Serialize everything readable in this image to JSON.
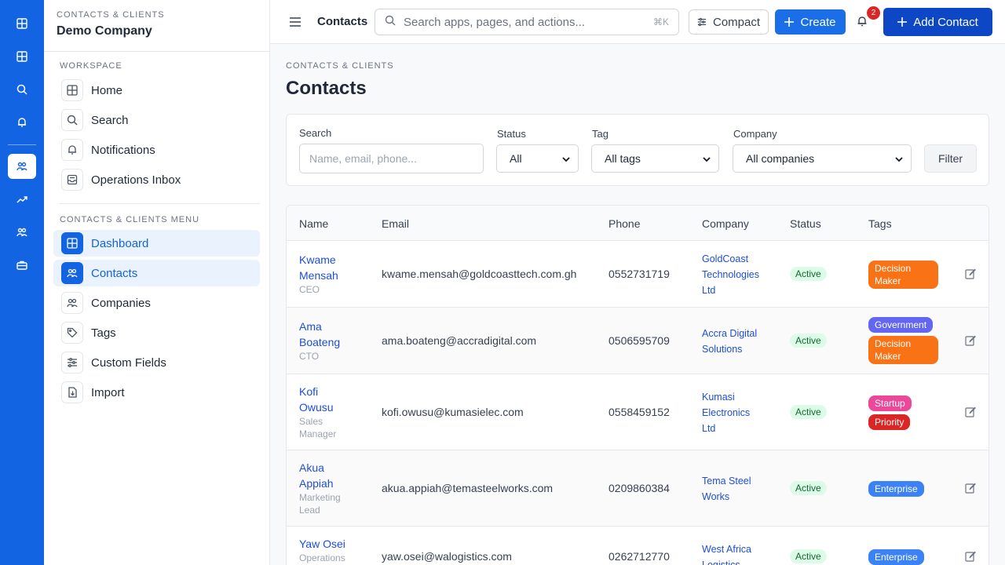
{
  "sidebar": {
    "kicker": "CONTACTS & CLIENTS",
    "company": "Demo Company",
    "workspace_title": "WORKSPACE",
    "workspace_items": [
      {
        "label": "Home",
        "icon": "grid-icon"
      },
      {
        "label": "Search",
        "icon": "search-icon"
      },
      {
        "label": "Notifications",
        "icon": "bell-icon"
      },
      {
        "label": "Operations Inbox",
        "icon": "inbox-icon"
      }
    ],
    "menu_title": "CONTACTS & CLIENTS MENU",
    "menu_items": [
      {
        "label": "Dashboard",
        "icon": "grid-icon",
        "active": true
      },
      {
        "label": "Contacts",
        "icon": "users-icon",
        "active": true
      },
      {
        "label": "Companies",
        "icon": "users-icon",
        "active": false
      },
      {
        "label": "Tags",
        "icon": "tag-icon",
        "active": false
      },
      {
        "label": "Custom Fields",
        "icon": "sliders-icon",
        "active": false
      },
      {
        "label": "Import",
        "icon": "file-import-icon",
        "active": false
      }
    ]
  },
  "topbar": {
    "title": "Contacts",
    "search_placeholder": "Search apps, pages, and actions...",
    "shortcut": "⌘K",
    "compact_label": "Compact",
    "create_label": "Create",
    "notification_count": "2",
    "add_contact_label": "Add Contact"
  },
  "page": {
    "breadcrumb": "CONTACTS & CLIENTS",
    "title": "Contacts"
  },
  "filters": {
    "search_label": "Search",
    "search_placeholder": "Name, email, phone...",
    "status_label": "Status",
    "status_value": "All",
    "tag_label": "Tag",
    "tag_value": "All tags",
    "company_label": "Company",
    "company_value": "All companies",
    "filter_button": "Filter"
  },
  "table": {
    "headers": [
      "Name",
      "Email",
      "Phone",
      "Company",
      "Status",
      "Tags"
    ],
    "rows": [
      {
        "name_l1": "Kwame",
        "name_l2": "Mensah",
        "role_l1": "CEO",
        "role_l2": "",
        "email": "kwame.mensah@goldcoasttech.com.gh",
        "phone": "0552731719",
        "company_l1": "GoldCoast",
        "company_l2": "Technologies",
        "company_l3": "Ltd",
        "status": "Active",
        "tags": [
          {
            "label": "Decision Maker",
            "color": "#f97316"
          }
        ]
      },
      {
        "name_l1": "Ama",
        "name_l2": "Boateng",
        "role_l1": "CTO",
        "role_l2": "",
        "email": "ama.boateng@accradigital.com",
        "phone": "0506595709",
        "company_l1": "Accra Digital",
        "company_l2": "Solutions",
        "company_l3": "",
        "status": "Active",
        "tags": [
          {
            "label": "Government",
            "color": "#6366f1"
          },
          {
            "label": "Decision Maker",
            "color": "#f97316"
          }
        ]
      },
      {
        "name_l1": "Kofi",
        "name_l2": "Owusu",
        "role_l1": "Sales",
        "role_l2": "Manager",
        "email": "kofi.owusu@kumasielec.com",
        "phone": "0558459152",
        "company_l1": "Kumasi",
        "company_l2": "Electronics",
        "company_l3": "Ltd",
        "status": "Active",
        "tags": [
          {
            "label": "Startup",
            "color": "#ec4899"
          },
          {
            "label": "Priority",
            "color": "#dc2626"
          }
        ]
      },
      {
        "name_l1": "Akua",
        "name_l2": "Appiah",
        "role_l1": "Marketing",
        "role_l2": "Lead",
        "email": "akua.appiah@temasteelworks.com",
        "phone": "0209860384",
        "company_l1": "Tema Steel",
        "company_l2": "Works",
        "company_l3": "",
        "status": "Active",
        "tags": [
          {
            "label": "Enterprise",
            "color": "#3b82f6"
          }
        ]
      },
      {
        "name_l1": "Yaw Osei",
        "name_l2": "",
        "role_l1": "Operations",
        "role_l2": "",
        "email": "yaw.osei@walogistics.com",
        "phone": "0262712770",
        "company_l1": "West Africa",
        "company_l2": "Logistics",
        "company_l3": "",
        "status": "Active",
        "tags": [
          {
            "label": "Enterprise",
            "color": "#3b82f6"
          }
        ]
      }
    ]
  },
  "colors": {
    "rail": "#1264e3",
    "primary": "#1a6ee8",
    "primary_dark": "#0d47c6",
    "link": "#1d4ed8"
  }
}
